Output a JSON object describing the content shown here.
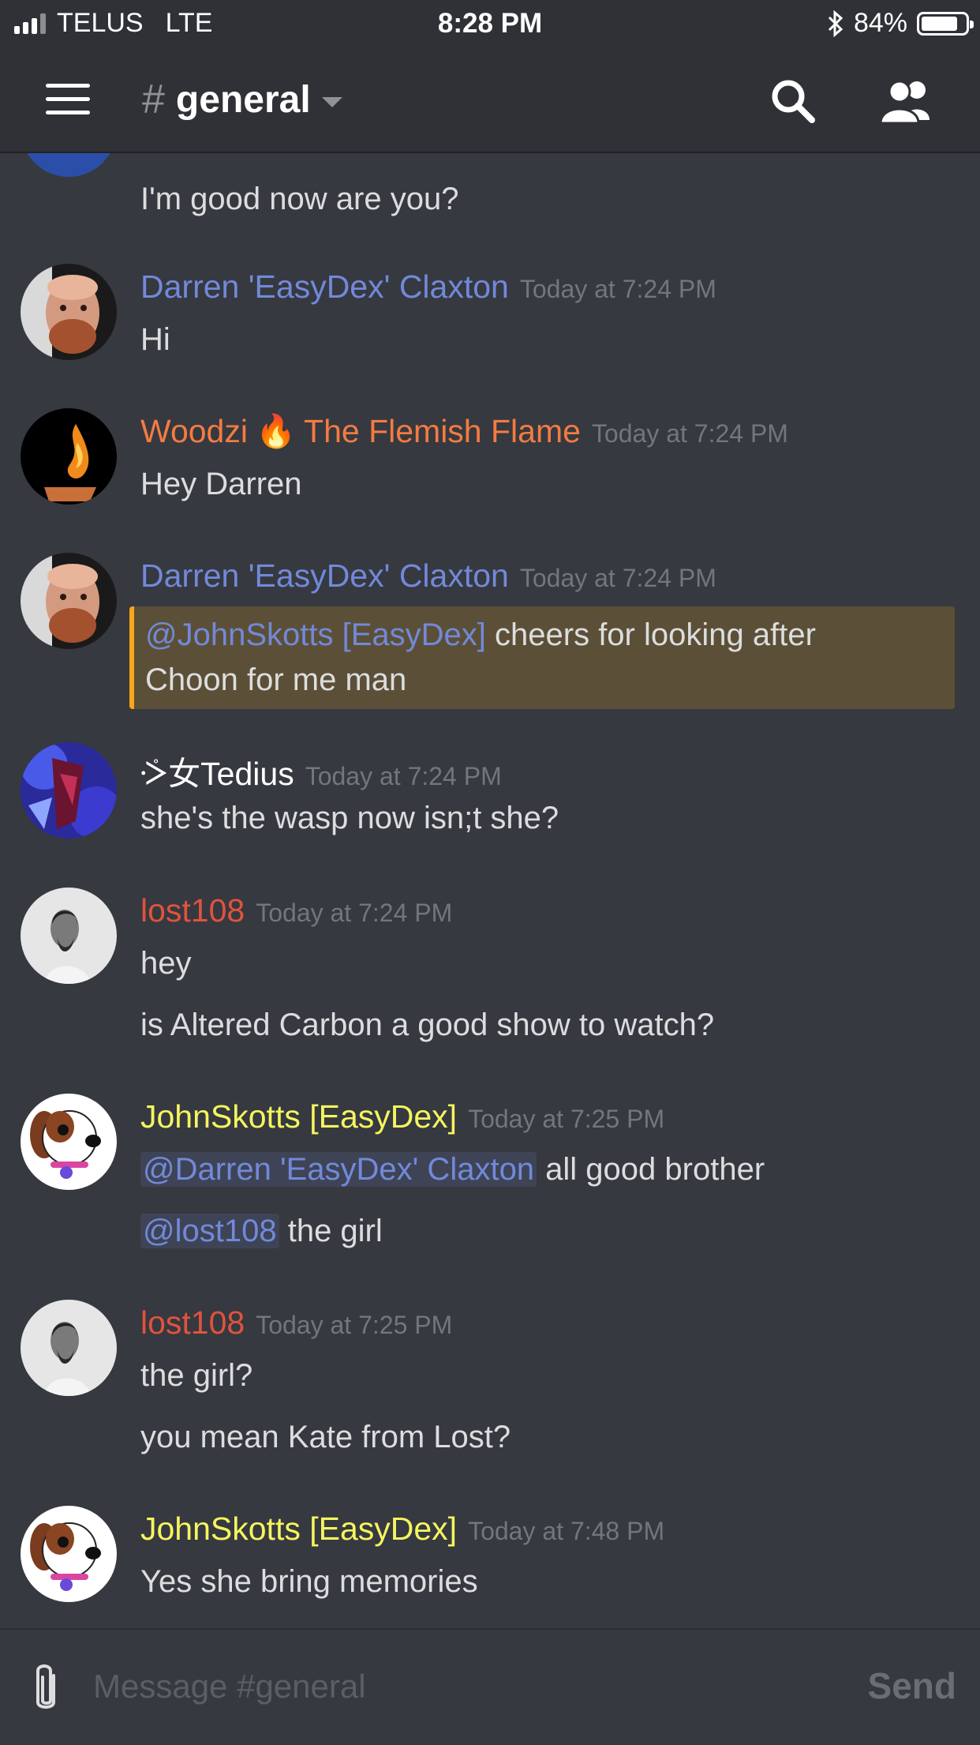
{
  "status_bar": {
    "carrier": "TELUS",
    "network": "LTE",
    "time": "8:28 PM",
    "battery": "84%",
    "battery_level": 0.84
  },
  "header": {
    "hash": "#",
    "channel_name": "general",
    "icons": [
      "menu-icon",
      "search-icon",
      "members-icon"
    ]
  },
  "partial_message": "I'm good now are you?",
  "messages": [
    {
      "author": "Darren 'EasyDex' Claxton",
      "color": "#7289da",
      "timestamp": "Today at 7:24 PM",
      "lines": [
        "Hi"
      ]
    },
    {
      "author": "Woodzi",
      "author_suffix": "The Flemish Flame",
      "emoji": "🔥",
      "color": "#f47b42",
      "timestamp": "Today at 7:24 PM",
      "lines": [
        "Hey Darren"
      ]
    },
    {
      "author": "Darren 'EasyDex' Claxton",
      "color": "#7289da",
      "timestamp": "Today at 7:24 PM",
      "mention": "@JohnSkotts [EasyDex]",
      "text_line1": " cheers for looking after",
      "text_line2": "Choon for me man"
    },
    {
      "author": "ᢶ⼥Tedius",
      "color": "#ffffff",
      "timestamp": "Today at 7:24 PM",
      "lines": [
        "she's the wasp now isn;t she?"
      ]
    },
    {
      "author": "lost108",
      "color": "#e0533d",
      "timestamp": "Today at 7:24 PM",
      "lines": [
        "hey",
        "is Altered Carbon a good show to watch?"
      ]
    },
    {
      "author": "JohnSkotts [EasyDex]",
      "color": "#f5f55f",
      "timestamp": "Today at 7:25 PM",
      "line1_mention": "@Darren 'EasyDex' Claxton",
      "line1_text": " all good brother",
      "line2_mention": "@lost108",
      "line2_text": " the girl"
    },
    {
      "author": "lost108",
      "color": "#e0533d",
      "timestamp": "Today at 7:25 PM",
      "lines": [
        "the girl?",
        "you mean Kate from Lost?"
      ]
    },
    {
      "author": "JohnSkotts [EasyDex]",
      "color": "#f5f55f",
      "timestamp": "Today at 7:48 PM",
      "lines": [
        "Yes she bring memories"
      ]
    }
  ],
  "input": {
    "placeholder": "Message #general",
    "send_label": "Send"
  },
  "colors": {
    "background": "#36393f",
    "header_bg": "#2f3136",
    "mention": "#7289da",
    "highlight_bg": "#5b5037",
    "highlight_border": "#faa61a"
  }
}
